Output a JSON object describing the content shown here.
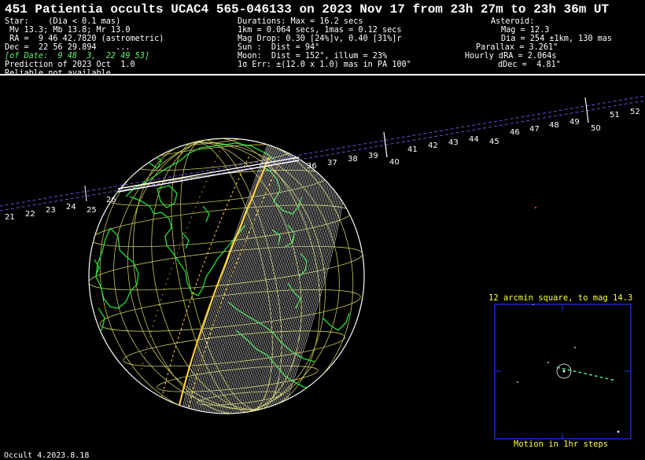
{
  "title": "451 Patientia occults UCAC4 565-046133 on 2023 Nov 17 from 23h 27m to 23h 36m UT",
  "star": {
    "lines": [
      "Star:    (Dia < 0.1 mas)",
      " Mv 13.3; Mb 13.8; Mr 13.0",
      " RA =  9 46 42.7820 (astrometric)",
      "Dec =  22 56 29.894    ...",
      "[of Date:  9 48  3,  22 49 53]",
      "Prediction of 2023 Oct  1.0",
      "Reliable not available"
    ]
  },
  "durations": {
    "lines": [
      "Durations: Max = 16.2 secs",
      "1km = 0.064 secs, 1mas = 0.12 secs",
      "Mag Drop: 0.30 [24%]v, 0.40 [31%]r",
      "Sun :  Dist = 94°",
      "Moon:  Dist = 152°, illum = 23%",
      "1σ Err: ±(12.0 x 1.0) mas in PA 100°"
    ]
  },
  "asteroid": {
    "lines": [
      "Asteroid:",
      "Mag = 12.3",
      "Dia = 254 ±1km, 130 mas",
      "Parallax = 3.261\"",
      "Hourly dRA = 2.064s",
      "dDec =  4.81\""
    ]
  },
  "path_ticks": [
    "21",
    "22",
    "23",
    "24",
    "25",
    "26",
    "36",
    "37",
    "38",
    "39",
    "40",
    "41",
    "42",
    "43",
    "44",
    "45",
    "46",
    "47",
    "48",
    "49",
    "50",
    "51",
    "52"
  ],
  "starfield": {
    "title": "12 arcmin square, to mag 14.3",
    "caption": "Motion in 1hr steps"
  },
  "footer": "Occult 4.2023.8.18",
  "colors": {
    "coast": "#22e03a",
    "grid": "#c8c85a",
    "path_edge": "#ffd23a",
    "path_line": "#6a4fd0",
    "box": "#2233ff",
    "caption": "#ffff3c"
  }
}
